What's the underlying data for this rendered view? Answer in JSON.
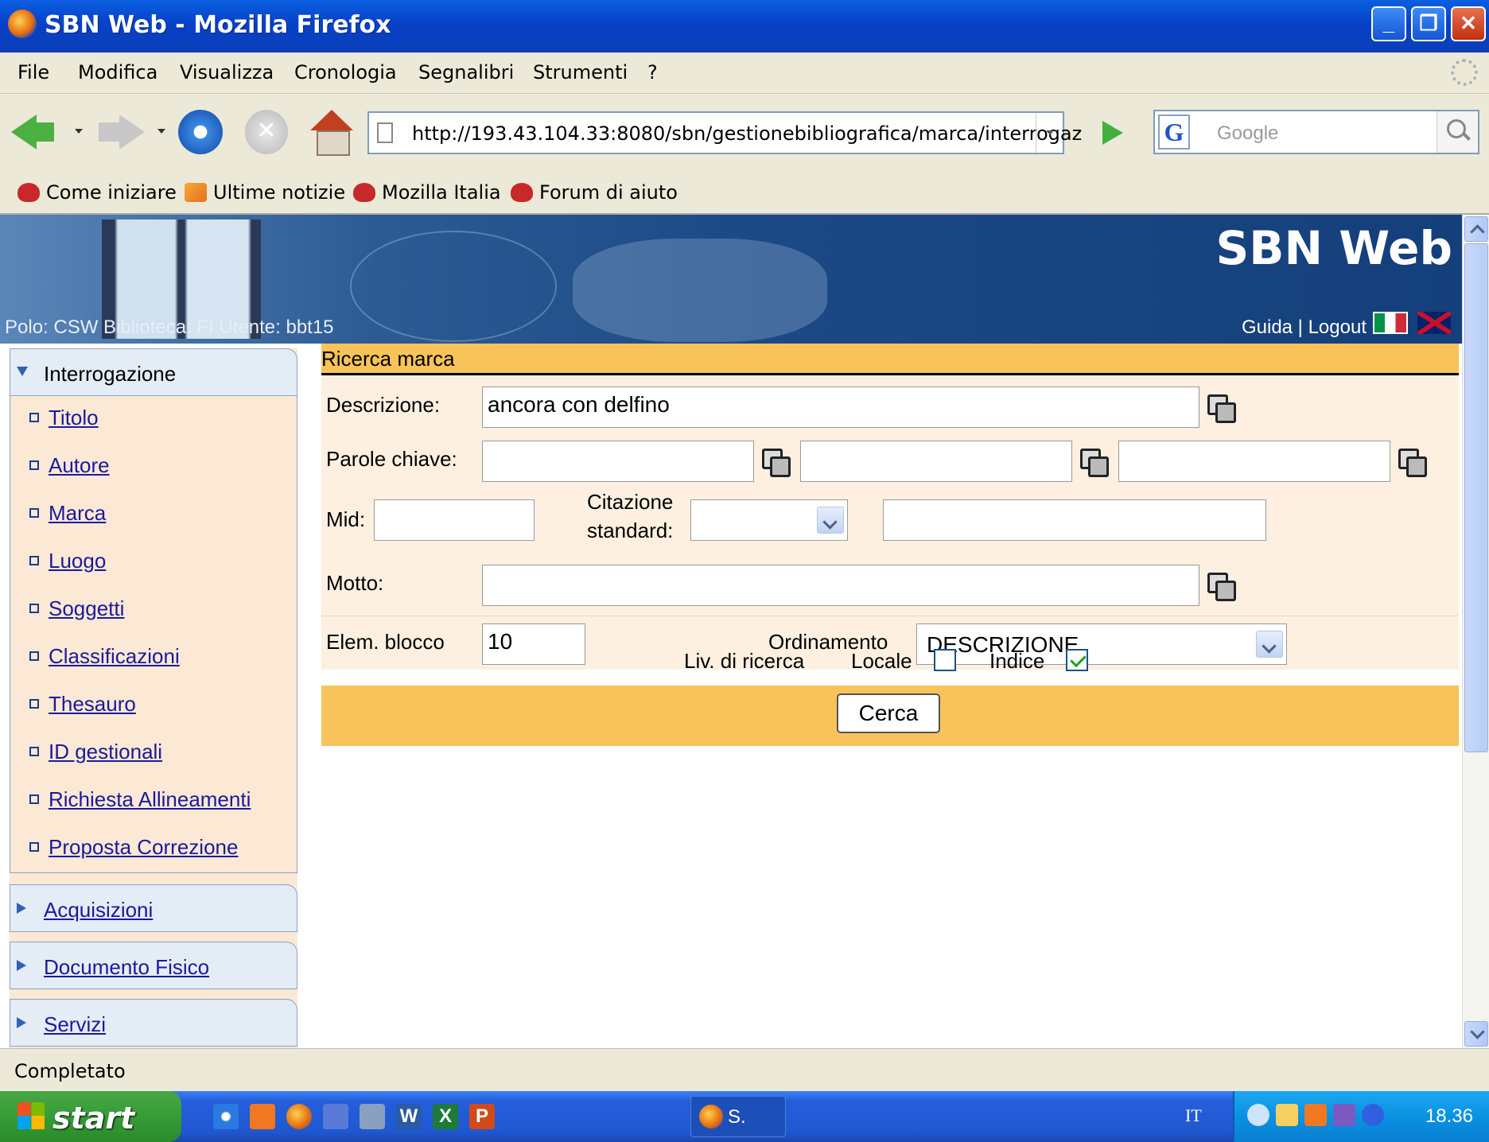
{
  "window": {
    "title": "SBN Web - Mozilla Firefox"
  },
  "menu": [
    "File",
    "Modifica",
    "Visualizza",
    "Cronologia",
    "Segnalibri",
    "Strumenti",
    "?"
  ],
  "navbar": {
    "url": "http://193.43.104.33:8080/sbn/gestionebibliografica/marca/interrogaz",
    "search_placeholder": "Google",
    "search_engine": "G"
  },
  "bookmarks": [
    "Come iniziare",
    "Ultime notizie",
    "Mozilla Italia",
    "Forum di aiuto"
  ],
  "banner": {
    "brand": "SBN Web",
    "session": "Polo: CSW  Biblioteca: FI  Utente: bbt15",
    "links": "Guida | Logout"
  },
  "sidebar": {
    "section": "Interrogazione",
    "items": [
      "Titolo",
      "Autore",
      "Marca",
      "Luogo",
      "Soggetti",
      "Classificazioni",
      "Thesauro",
      "ID gestionali",
      "Richiesta Allineamenti",
      "Proposta Correzione"
    ],
    "collapsed": [
      "Acquisizioni",
      "Documento Fisico",
      "Servizi"
    ]
  },
  "form": {
    "heading": "Ricerca marca",
    "descrizione_label": "Descrizione:",
    "descrizione_value": "ancora con delfino",
    "parole_label": "Parole chiave:",
    "mid_label": "Mid:",
    "citazione_label_1": "Citazione",
    "citazione_label_2": "standard:",
    "motto_label": "Motto:",
    "elem_label": "Elem. blocco",
    "elem_value": "10",
    "ordinamento_label": "Ordinamento",
    "ordinamento_value": "DESCRIZIONE",
    "livello_label": "Liv. di ricerca",
    "locale_label": "Locale",
    "locale_checked": false,
    "indice_label": "Indice",
    "indice_checked": true,
    "cerca": "Cerca"
  },
  "status": "Completato",
  "taskbar": {
    "start": "start",
    "task_label": "S.",
    "lang": "IT",
    "clock": "18.36"
  },
  "colors": {
    "form_header": "#f8c35a",
    "form_bg": "#fdf0e0",
    "sidebar_bg": "#fbe9d6",
    "link": "#1a1a9c"
  }
}
